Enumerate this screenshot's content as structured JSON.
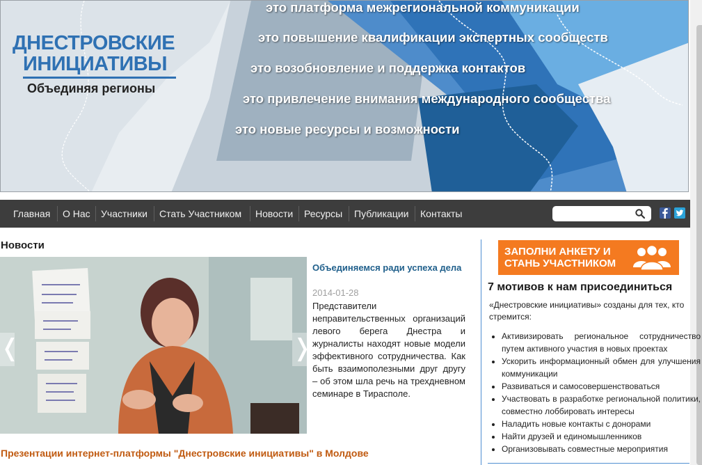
{
  "banner": {
    "logo_line1": "ДНЕСТРОВСКИЕ",
    "logo_line2": "ИНИЦИАТИВЫ",
    "logo_tagline": "Объединяя регионы",
    "slogans": [
      "это платформа межрегиональной коммуникации",
      "это повышение квалификации экспертных сообществ",
      "это возобновление и поддержка контактов",
      "это привлечение внимания международного сообщества",
      "это новые ресурсы и возможности"
    ]
  },
  "nav": {
    "items": [
      "Главная",
      "О Нас",
      "Участники",
      "Стать Участником",
      "Новости",
      "Ресурсы",
      "Публикации",
      "Контакты"
    ]
  },
  "search": {
    "placeholder": "",
    "icon": "search-icon"
  },
  "social": {
    "facebook_icon": "facebook-icon",
    "twitter_icon": "twitter-icon"
  },
  "news": {
    "heading": "Новости",
    "featured": {
      "title": "Объединяемся ради успеха дела",
      "date": "2014-01-28",
      "text": "Представители неправительственных организаций левого берега Днестра и журналисты находят новые модели эффективного сотрудничества. Как быть взаимополезными друг другу – об этом шла речь на трехдневном семинаре в Тирасполе.",
      "prev_arrow": "❬",
      "next_arrow": "❭"
    },
    "second_link": "Презентации интернет-платформы \"Днестровские инициативы\" в Молдове"
  },
  "sidebar": {
    "cta_line1": "ЗАПОЛНИ АНКЕТУ И",
    "cta_line2": "СТАНЬ УЧАСТНИКОМ",
    "motives_heading": "7 мотивов к нам присоединиться",
    "intro": "«Днестровские инициативы» созданы для тех, кто стремится:",
    "motives": [
      "Активизировать региональное сотрудничество путем активного участия в новых проектах",
      "Ускорить информационный обмен для улучшения коммуникации",
      "Развиваться и самосовершенствоваться",
      "Участвовать в разработке региональной политики, совместно лоббировать интересы",
      "Наладить новые контакты с донорами",
      "Найти друзей и единомышленников",
      "Организовывать совместные мероприятия"
    ]
  },
  "colors": {
    "accent_blue": "#2f71b3",
    "nav_bg": "#3d3d3d",
    "cta_orange": "#f47a20",
    "link_orange": "#c05a10"
  }
}
